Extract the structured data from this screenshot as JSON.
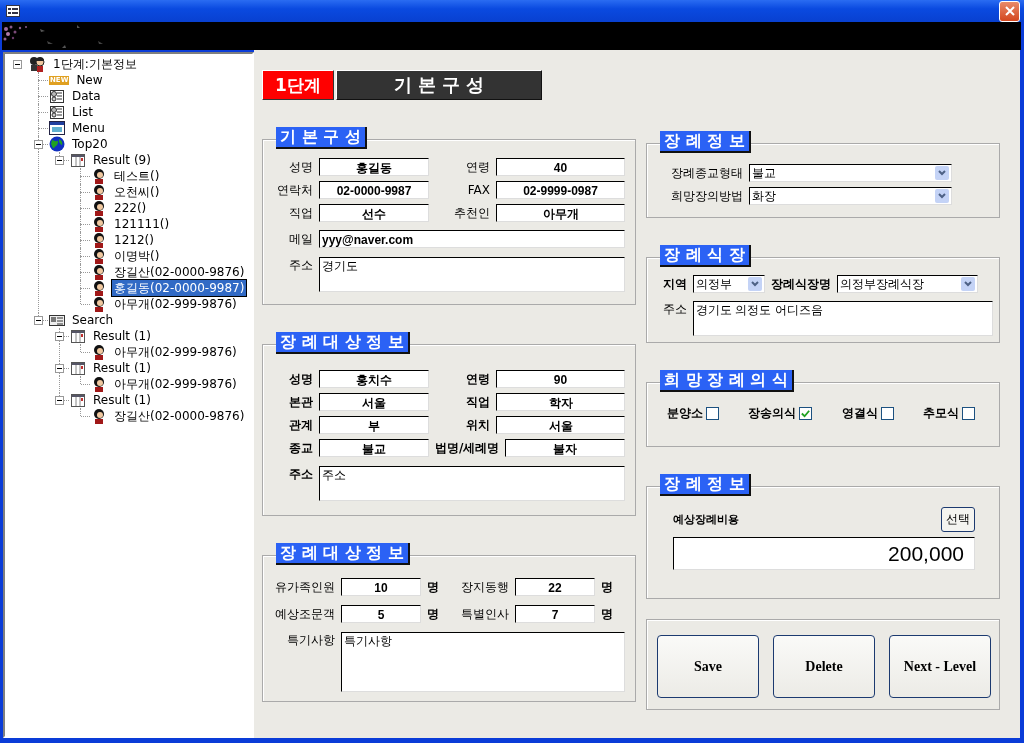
{
  "tree": [
    {
      "label": "1단계:기본정보",
      "kind": "people",
      "expanded": true,
      "selected": false,
      "children": [
        {
          "label": "New",
          "kind": "new",
          "badge": "NEW",
          "selected": false
        },
        {
          "label": "Data",
          "kind": "doc",
          "selected": false
        },
        {
          "label": "List",
          "kind": "doc",
          "selected": false
        },
        {
          "label": "Menu",
          "kind": "menu",
          "selected": false
        },
        {
          "label": "Top20",
          "kind": "globe",
          "expanded": true,
          "selected": false,
          "children": [
            {
              "label": "Result (9)",
              "kind": "table",
              "expanded": true,
              "selected": false,
              "children": [
                {
                  "label": "테스트()",
                  "kind": "person",
                  "selected": false
                },
                {
                  "label": "오천씨()",
                  "kind": "person",
                  "selected": false
                },
                {
                  "label": "222()",
                  "kind": "person",
                  "selected": false
                },
                {
                  "label": "121111()",
                  "kind": "person",
                  "selected": false
                },
                {
                  "label": "1212()",
                  "kind": "person",
                  "selected": false
                },
                {
                  "label": "이명박()",
                  "kind": "person",
                  "selected": false
                },
                {
                  "label": "장길산(02-0000-9876)",
                  "kind": "person",
                  "selected": false
                },
                {
                  "label": "홍길동(02-0000-9987)",
                  "kind": "person",
                  "selected": true
                },
                {
                  "label": "아무개(02-999-9876)",
                  "kind": "person",
                  "selected": false
                }
              ]
            }
          ]
        },
        {
          "label": "Search",
          "kind": "card",
          "expanded": true,
          "selected": false,
          "children": [
            {
              "label": "Result (1)",
              "kind": "table",
              "expanded": true,
              "selected": false,
              "children": [
                {
                  "label": "아무개(02-999-9876)",
                  "kind": "person",
                  "selected": false
                }
              ]
            },
            {
              "label": "Result (1)",
              "kind": "table",
              "expanded": true,
              "selected": false,
              "children": [
                {
                  "label": "아무개(02-999-9876)",
                  "kind": "person",
                  "selected": false
                }
              ]
            },
            {
              "label": "Result (1)",
              "kind": "table",
              "expanded": true,
              "selected": false,
              "children": [
                {
                  "label": "장길산(02-0000-9876)",
                  "kind": "person",
                  "selected": false
                }
              ]
            }
          ]
        }
      ]
    }
  ],
  "stage": {
    "step": "1단계",
    "title": "기 본 구 성"
  },
  "basic_info": {
    "title": "기 본 구 성",
    "rows": [
      [
        {
          "label": "성명",
          "value": "홍길동"
        },
        {
          "label": "연령",
          "value": "40"
        }
      ],
      [
        {
          "label": "연락처",
          "value": "02-0000-9987"
        },
        {
          "label": "FAX",
          "value": "02-9999-0987"
        }
      ],
      [
        {
          "label": "직업",
          "value": "선수"
        },
        {
          "label": "추천인",
          "value": "아무개"
        }
      ],
      [
        {
          "label": "메일",
          "value": "yyy@naver.com",
          "kind": "wide"
        }
      ],
      [
        {
          "label": "주소",
          "value": "경기도",
          "kind": "area"
        }
      ]
    ]
  },
  "deceased_info": {
    "title": "장 례 대 상 정 보",
    "rows": [
      [
        {
          "label": "성명",
          "value": "홍치수"
        },
        {
          "label": "연령",
          "value": "90"
        }
      ],
      [
        {
          "label": "본관",
          "value": "서울"
        },
        {
          "label": "직업",
          "value": "학자"
        }
      ],
      [
        {
          "label": "관계",
          "value": "부"
        },
        {
          "label": "위치",
          "value": "서울"
        }
      ],
      [
        {
          "label": "종교",
          "value": "불교"
        },
        {
          "label": "법명/세례명",
          "value": "불자"
        }
      ],
      [
        {
          "label": "주소",
          "value": "주소",
          "kind": "area"
        }
      ]
    ]
  },
  "attendance": {
    "title": "장 례 대 상 정 보",
    "rows": [
      [
        {
          "label": "유가족인원",
          "value": "10",
          "unit": "명"
        },
        {
          "label": "장지동행",
          "value": "22",
          "unit": "명"
        }
      ],
      [
        {
          "label": "예상조문객",
          "value": "5",
          "unit": "명"
        },
        {
          "label": "특별인사",
          "value": "7",
          "unit": "명"
        }
      ]
    ],
    "note": {
      "label": "특기사항",
      "value": "특기사항"
    }
  },
  "funeral_info": {
    "title": "장 례 정 보",
    "selects": [
      {
        "label": "장례종교형태",
        "value": "불교"
      },
      {
        "label": "희망장의방법",
        "value": "화장"
      }
    ]
  },
  "funeral_hall": {
    "title": "장 례 식 장",
    "region": {
      "label": "지역",
      "value": "의정부"
    },
    "hall": {
      "label": "장례식장명",
      "value": "의정부장례식장"
    },
    "address": {
      "label": "주소",
      "value": "경기도 의정도 어디즈음"
    }
  },
  "ceremonies": {
    "title": "희 망 장 례 의 식",
    "options": [
      {
        "label": "분양소",
        "checked": false
      },
      {
        "label": "장송의식",
        "checked": true
      },
      {
        "label": "영결식",
        "checked": false
      },
      {
        "label": "추모식",
        "checked": false
      }
    ]
  },
  "cost": {
    "title": "장 례 정 보",
    "label": "예상장례비용",
    "button": "선택",
    "value": "200,000"
  },
  "buttons": [
    "Save",
    "Delete",
    "Next - Level"
  ]
}
